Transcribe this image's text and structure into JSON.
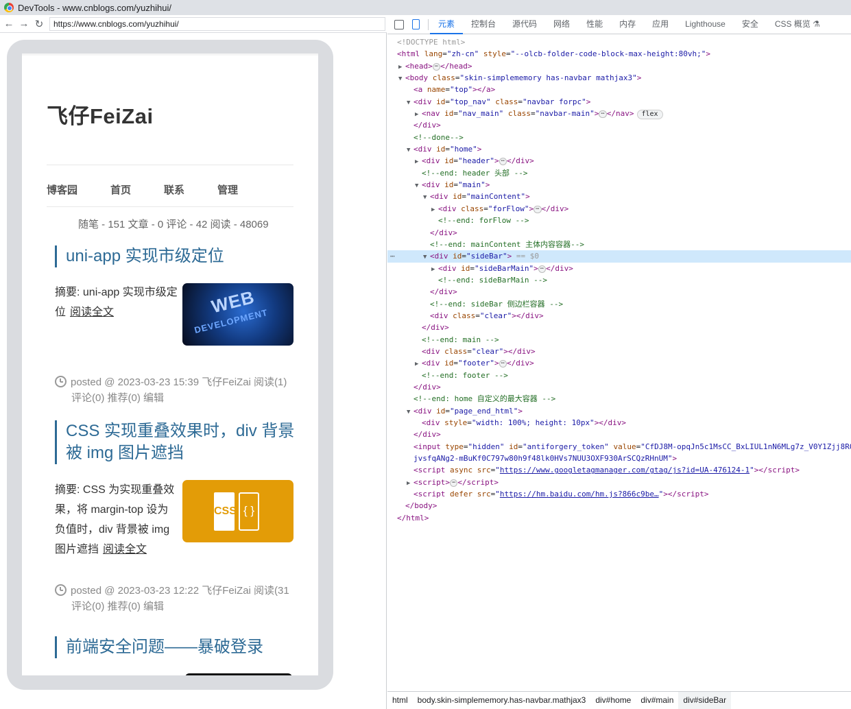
{
  "window": {
    "title": "DevTools - www.cnblogs.com/yuzhihui/"
  },
  "browser": {
    "url": "https://www.cnblogs.com/yuzhihui/",
    "back_icon": "back-arrow-icon",
    "forward_icon": "forward-arrow-icon",
    "reload_icon": "reload-icon"
  },
  "blog": {
    "title": "飞仔FeiZai",
    "nav": [
      "博客园",
      "首页",
      "联系",
      "管理"
    ],
    "stats": "随笔 - 151  文章 - 0  评论 - 42  阅读 - 48069",
    "posts": [
      {
        "title": "uni-app 实现市级定位",
        "summary": "摘要:   uni-app 实现市级定位",
        "read_more": "阅读全文",
        "thumb_line1": "WEB",
        "thumb_line2": "DEVELOPMENT",
        "meta1": "posted @ 2023-03-23 15:39 飞仔FeiZai 阅读(1)",
        "meta2": "评论(0) 推荐(0) 编辑"
      },
      {
        "title": "CSS 实现重叠效果时，div 背景被 img 图片遮挡",
        "summary": "摘要:   CSS 为实现重叠效果，将 margin-top 设为负值时，div 背景被 img 图片遮挡",
        "read_more": "阅读全文",
        "thumb_doc": "CSS",
        "thumb_brace": "{ }",
        "meta1": "posted @ 2023-03-23 12:22 飞仔FeiZai 阅读(31",
        "meta2": "评论(0) 推荐(0) 编辑"
      },
      {
        "title": "前端安全问题——暴破登录"
      }
    ]
  },
  "devtools": {
    "tabs": [
      "元素",
      "控制台",
      "源代码",
      "网络",
      "性能",
      "内存",
      "应用",
      "Lighthouse",
      "安全",
      "CSS 概览 ⚗"
    ],
    "active_tab": "元素",
    "selected_marker": "== $0",
    "badge_flex": "flex",
    "breadcrumbs": [
      "html",
      "body.skin-simplememory.has-navbar.mathjax3",
      "div#home",
      "div#main",
      "div#sideBar"
    ],
    "colors": {
      "tag": "#881280",
      "attr_name": "#994500",
      "attr_value": "#1a1aa6",
      "comment": "#236e25",
      "accent": "#1a73e8"
    }
  }
}
